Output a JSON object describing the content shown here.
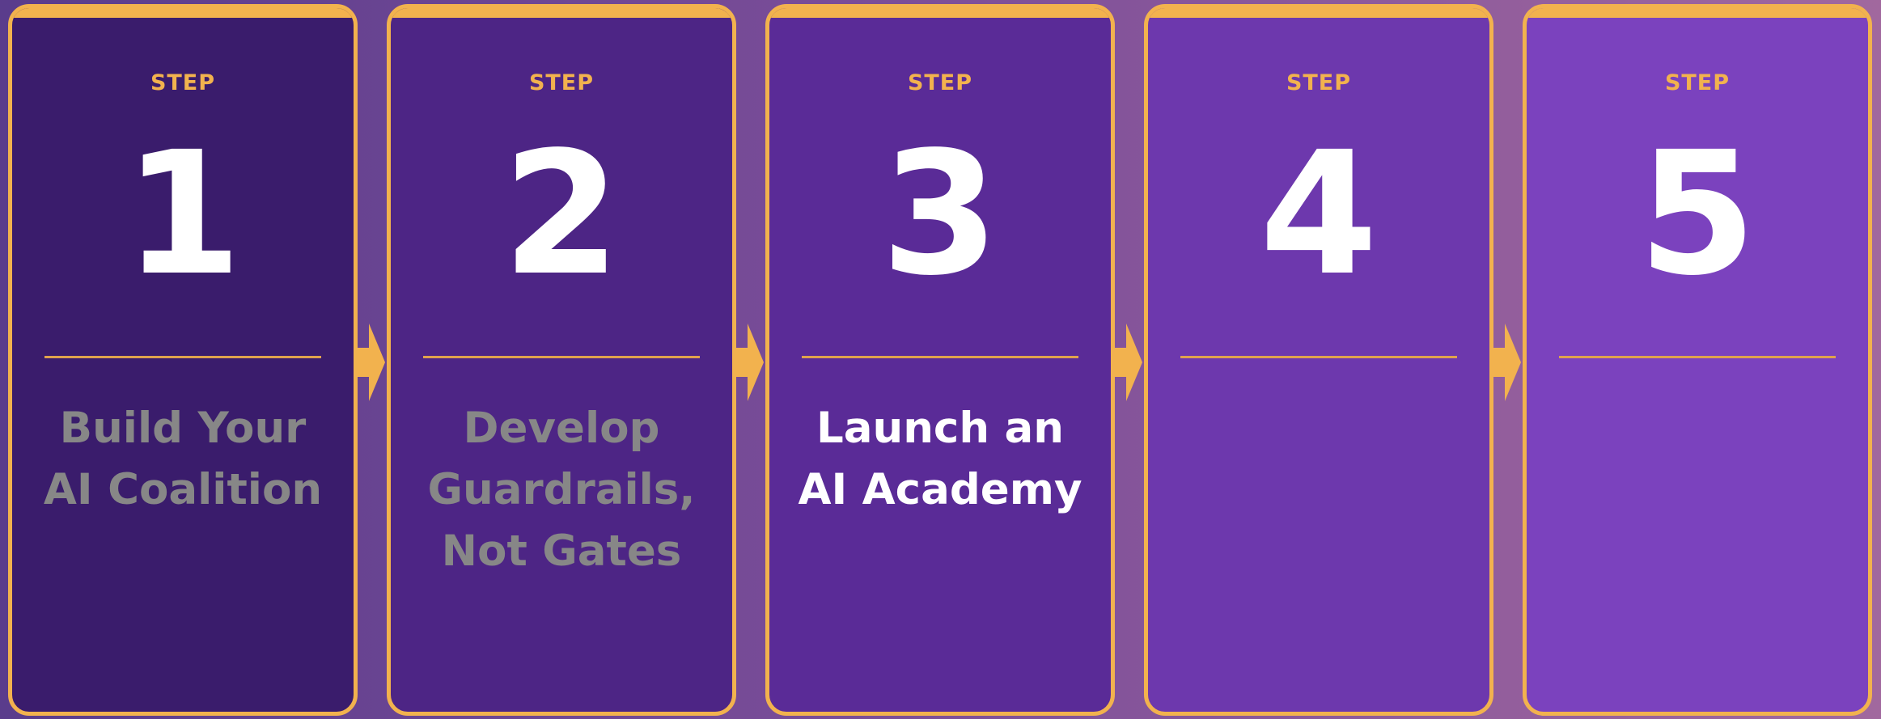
{
  "colors": {
    "accent": "#f2b24e",
    "muted_text": "#878787",
    "active_text": "#ffffff",
    "card_fills": [
      "#3a1c6c",
      "#4d2585",
      "#5a2b97",
      "#6d38ad",
      "#7b42be"
    ]
  },
  "steps": [
    {
      "label": "STEP",
      "number": "1",
      "title_lines": [
        "Build Your",
        "AI Coalition"
      ],
      "state": "muted"
    },
    {
      "label": "STEP",
      "number": "2",
      "title_lines": [
        "Develop",
        "Guardrails,",
        "Not Gates"
      ],
      "state": "muted"
    },
    {
      "label": "STEP",
      "number": "3",
      "title_lines": [
        "Launch an",
        "AI Academy"
      ],
      "state": "active"
    },
    {
      "label": "STEP",
      "number": "4",
      "title_lines": [],
      "state": "empty"
    },
    {
      "label": "STEP",
      "number": "5",
      "title_lines": [],
      "state": "empty"
    }
  ]
}
